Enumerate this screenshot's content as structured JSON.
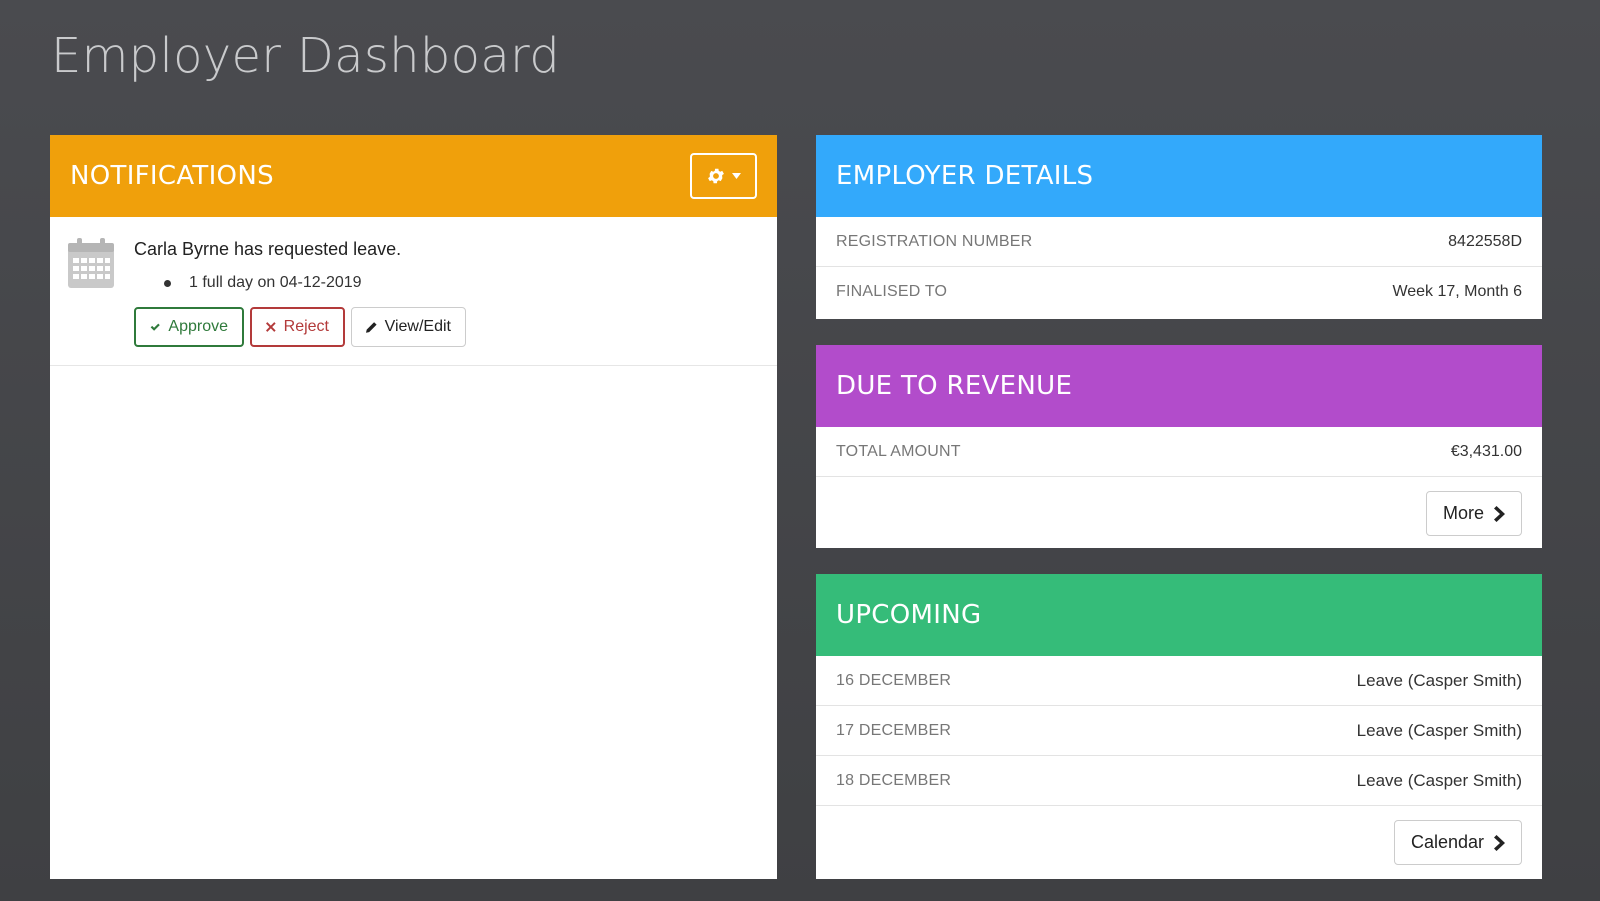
{
  "page": {
    "title": "Employer Dashboard"
  },
  "notifications": {
    "header": "NOTIFICATIONS",
    "items": [
      {
        "title": "Carla Byrne has requested leave.",
        "detail": "1 full day on 04-12-2019",
        "approve_label": "Approve",
        "reject_label": "Reject",
        "edit_label": "View/Edit"
      }
    ]
  },
  "employer_details": {
    "header": "EMPLOYER DETAILS",
    "rows": [
      {
        "label": "REGISTRATION NUMBER",
        "value": "8422558D"
      },
      {
        "label": "FINALISED TO",
        "value": "Week 17, Month 6"
      }
    ]
  },
  "due_to_revenue": {
    "header": "DUE TO REVENUE",
    "rows": [
      {
        "label": "TOTAL AMOUNT",
        "value": "€3,431.00"
      }
    ],
    "more_label": "More"
  },
  "upcoming": {
    "header": "UPCOMING",
    "rows": [
      {
        "label": "16 DECEMBER",
        "value": "Leave (Casper Smith)"
      },
      {
        "label": "17 DECEMBER",
        "value": "Leave (Casper Smith)"
      },
      {
        "label": "18 DECEMBER",
        "value": "Leave (Casper Smith)"
      }
    ],
    "calendar_label": "Calendar"
  },
  "colors": {
    "notifications": "#f0a00b",
    "employer_details": "#33a9fb",
    "due_to_revenue": "#b24ccb",
    "upcoming": "#35bc79",
    "approve": "#2f7a3b",
    "reject": "#b33a3a"
  },
  "icons": {
    "settings": "gear-icon",
    "notification": "calendar-icon",
    "approve": "check-icon",
    "reject": "x-icon",
    "edit": "pencil-icon",
    "more": "chevron-right-icon"
  }
}
